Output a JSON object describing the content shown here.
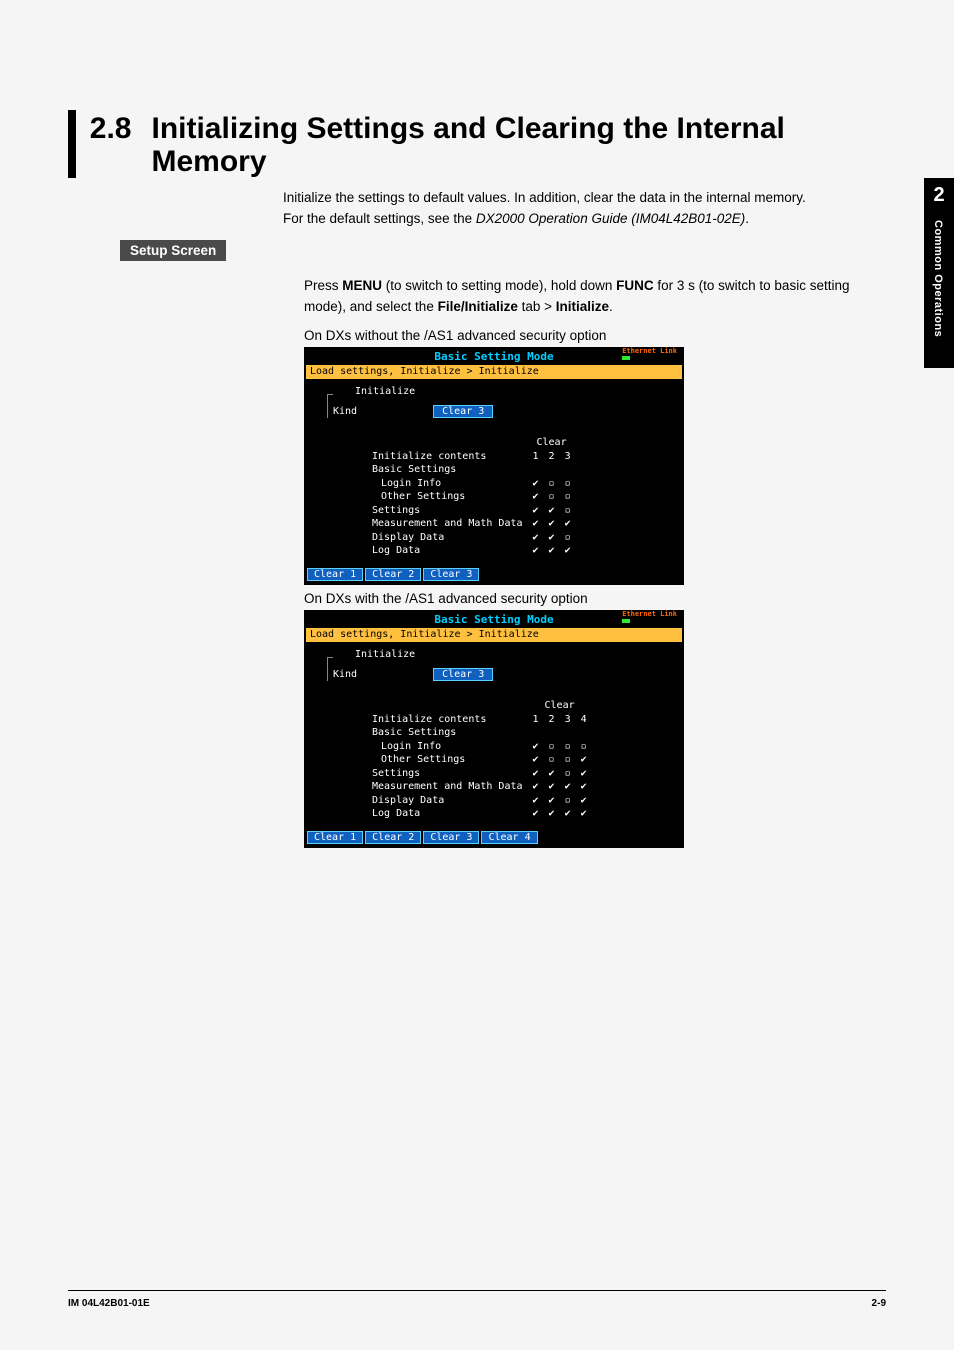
{
  "section": {
    "number": "2.8",
    "title": "Initializing Settings and Clearing the Internal Memory"
  },
  "intro": {
    "line1": "Initialize the settings to default values. In addition, clear the data in the internal memory.",
    "line2_a": "For the default settings, see the ",
    "line2_i": "DX2000 Operation Guide (IM04L42B01-02E)",
    "line2_b": "."
  },
  "setup_label": "Setup Screen",
  "instruction": {
    "a": "Press ",
    "menu": "MENU",
    "b": " (to switch to setting mode), hold down ",
    "func": "FUNC",
    "c": " for 3 s (to switch to basic setting mode), and select the ",
    "tab": "File/Initialize",
    "d": " tab > ",
    "item": "Initialize",
    "e": "."
  },
  "cap1": "On DXs without the /AS1 advanced security option",
  "cap2": "On DXs with the /AS1 advanced security option",
  "screen": {
    "title": "Basic Setting Mode",
    "eth": "Ethernet\nLink",
    "breadcrumb": "Load settings, Initialize > Initialize",
    "group": "Initialize",
    "kind_label": "Kind",
    "kind_value": "Clear 3",
    "col_head": "Clear",
    "cols3": [
      "1",
      "2",
      "3"
    ],
    "cols4": [
      "1",
      "2",
      "3",
      "4"
    ],
    "head1": "Initialize contents",
    "head2": "Basic Settings",
    "rows": [
      "Login Info",
      "Other Settings",
      "Settings",
      "Measurement and Math Data",
      "Display Data",
      "Log Data"
    ],
    "grid3": [
      [
        "v",
        "-",
        "-"
      ],
      [
        "v",
        "-",
        "-"
      ],
      [
        "v",
        "v",
        "-"
      ],
      [
        "v",
        "v",
        "v"
      ],
      [
        "v",
        "v",
        "-"
      ],
      [
        "v",
        "v",
        "v"
      ]
    ],
    "grid4": [
      [
        "v",
        "-",
        "-",
        "-"
      ],
      [
        "v",
        "-",
        "-",
        "v"
      ],
      [
        "v",
        "v",
        "-",
        "v"
      ],
      [
        "v",
        "v",
        "v",
        "v"
      ],
      [
        "v",
        "v",
        "-",
        "v"
      ],
      [
        "v",
        "v",
        "v",
        "v"
      ]
    ],
    "soft3": [
      "Clear 1",
      "Clear 2",
      "Clear 3"
    ],
    "soft4": [
      "Clear 1",
      "Clear 2",
      "Clear 3",
      "Clear 4"
    ]
  },
  "sidetab": {
    "num": "2",
    "text": "Common Operations"
  },
  "footer": {
    "left": "IM 04L42B01-01E",
    "right": "2-9"
  }
}
